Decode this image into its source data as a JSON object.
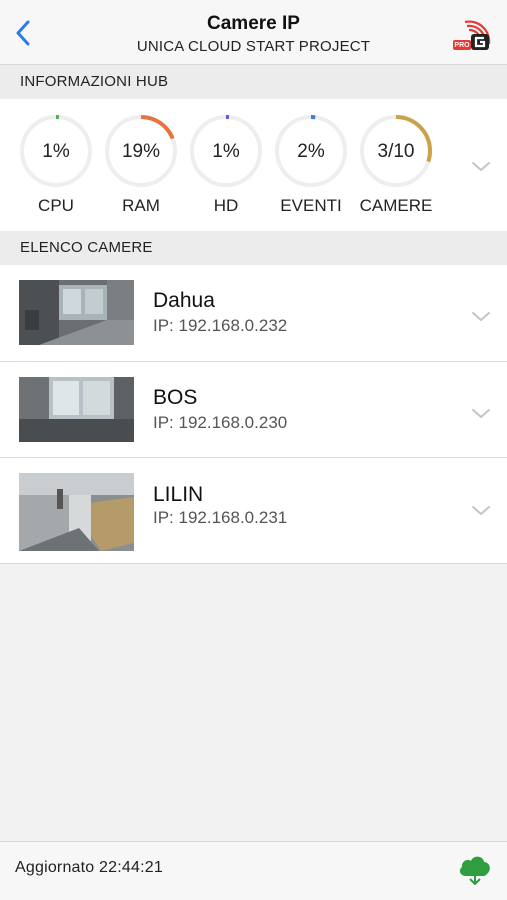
{
  "header": {
    "title": "Camere IP",
    "subtitle": "UNICA CLOUD START PROJECT",
    "back_icon": "chevron-left-icon",
    "logo_icon": "pro-wifi-logo",
    "logo_text": "PRO"
  },
  "hub": {
    "section_title": "INFORMAZIONI HUB",
    "stats": [
      {
        "value": "1%",
        "label": "CPU",
        "fraction": 0.01,
        "color": "#4caf50"
      },
      {
        "value": "19%",
        "label": "RAM",
        "fraction": 0.19,
        "color": "#e8743b"
      },
      {
        "value": "1%",
        "label": "HD",
        "fraction": 0.01,
        "color": "#5b5bd6"
      },
      {
        "value": "2%",
        "label": "EVENTI",
        "fraction": 0.02,
        "color": "#3d7fd6"
      },
      {
        "value": "3/10",
        "label": "CAMERE",
        "fraction": 0.3,
        "color": "#c9a24a"
      }
    ]
  },
  "cameras": {
    "section_title": "ELENCO CAMERE",
    "items": [
      {
        "name": "Dahua",
        "ip": "IP: 192.168.0.232"
      },
      {
        "name": "BOS",
        "ip": "IP: 192.168.0.230"
      },
      {
        "name": "LILIN",
        "ip": "IP: 192.168.0.231"
      }
    ]
  },
  "footer": {
    "updated": "Aggiornato 22:44:21",
    "cloud_icon": "cloud-download-icon",
    "accent": "#2e9e3e"
  }
}
